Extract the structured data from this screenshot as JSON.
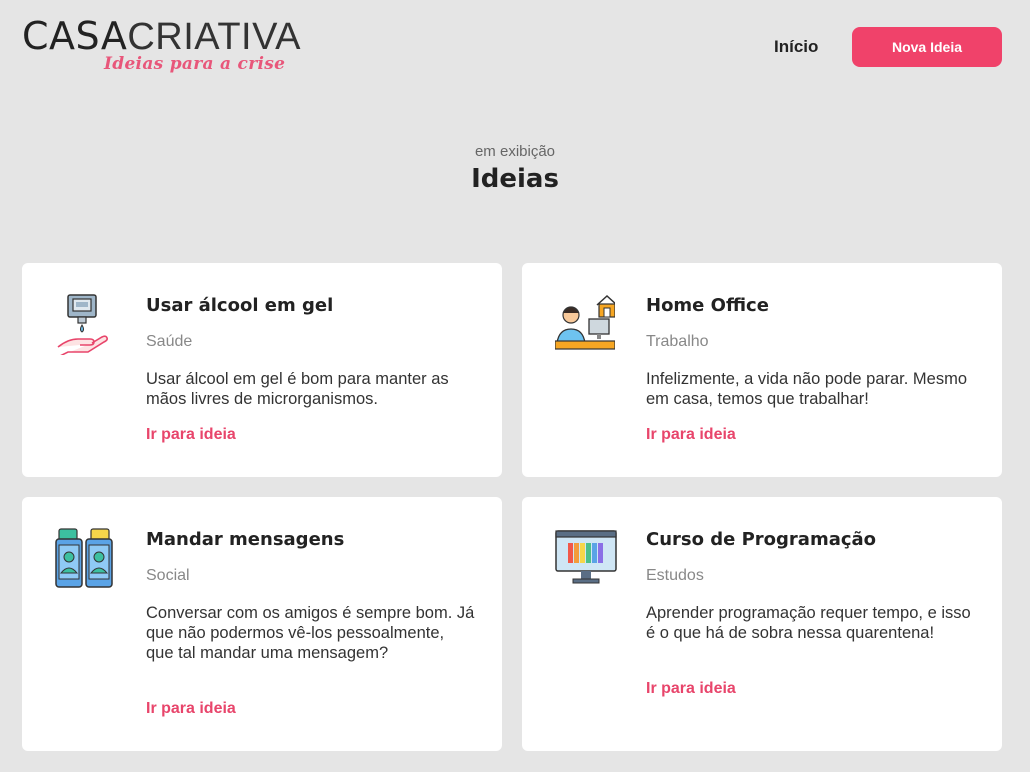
{
  "header": {
    "logo_main_a": "CASA",
    "logo_main_b": "CRIATIVA",
    "logo_sub": "Ideias para a crise",
    "nav_home": "Início",
    "new_idea_button": "Nova Ideia"
  },
  "section": {
    "subtitle": "em exibição",
    "title": "Ideias"
  },
  "ideas": [
    {
      "title": "Usar álcool em gel",
      "category": "Saúde",
      "description": "Usar álcool em gel é bom para manter as mãos livres de microrganismos.",
      "link": "Ir para ideia",
      "icon": "hand-sanitizer-icon"
    },
    {
      "title": "Home Office",
      "category": "Trabalho",
      "description": "Infelizmente, a vida não pode parar. Mesmo em casa, temos que trabalhar!",
      "link": "Ir para ideia",
      "icon": "home-office-icon"
    },
    {
      "title": "Mandar mensagens",
      "category": "Social",
      "description": "Conversar com os amigos é sempre bom. Já que não podermos vê-los pessoalmente, que tal mandar uma mensagem?",
      "link": "Ir para ideia",
      "icon": "phone-messages-icon"
    },
    {
      "title": "Curso de Programação",
      "category": "Estudos",
      "description": "Aprender programação requer tempo, e isso é o que há de sobra nessa quarentena!",
      "link": "Ir para ideia",
      "icon": "monitor-code-icon"
    }
  ],
  "colors": {
    "background": "#e5e5e5",
    "accent": "#f0426a",
    "card": "#ffffff"
  }
}
